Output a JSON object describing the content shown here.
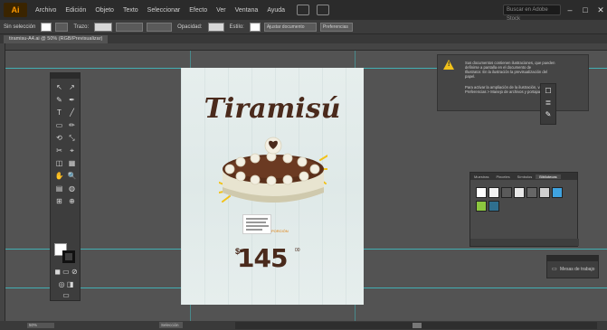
{
  "app": {
    "logo": "Ai",
    "menu": [
      "Archivo",
      "Edición",
      "Objeto",
      "Texto",
      "Seleccionar",
      "Efecto",
      "Ver",
      "Ventana",
      "Ayuda"
    ],
    "search_placeholder": "Buscar en Adobe Stock",
    "window_controls": [
      "–",
      "□",
      "✕"
    ]
  },
  "control_bar": {
    "selection_label": "Sin selección",
    "stroke_label": "Trazo:",
    "opacity_label": "Opacidad:",
    "style_label": "Estilo:",
    "doc_setup_button": "Ajustar documento",
    "preferences_button": "Preferencias"
  },
  "document": {
    "tab_title": "tiramisu-A4.ai @ 50% (RGB/Previsualizar)"
  },
  "artboard": {
    "title": "Tiramisú",
    "price": "145",
    "price_currency": "$",
    "price_superscript": "00",
    "info_tag": "PORCIÓN"
  },
  "toolbox": {
    "tools": [
      "↖",
      "↗",
      "✎",
      "✒",
      "T",
      "╱",
      "▭",
      "✏",
      "⟲",
      "⤡",
      "✂",
      "⌖",
      "◫",
      "▦",
      "✋",
      "🔍",
      "▤",
      "◍",
      "⊞",
      "⊕"
    ]
  },
  "warning_panel": {
    "line1": "Sus documentos contienen ilustraciones, que pueden",
    "line2": "definirse a pantalla en el documento de",
    "line3": "Illustrator. En la ilustración la previsualización del",
    "line4": "papel.",
    "line5": "Para activar la ampliación de la ilustración, vaya a",
    "line6": "Preferencias > Manejo de archivos y portapapeles."
  },
  "swatches_panel": {
    "tabs": [
      "Muestras",
      "Pinceles",
      "Símbolos",
      "Bibliotecas"
    ]
  },
  "artboards_panel": {
    "label": "Mesas de trabajo"
  },
  "status_bar": {
    "zoom": "50%",
    "tool": "Selección"
  },
  "colors": {
    "accent": "#ef7c0e",
    "title_brown": "#4a2a1c",
    "guide": "#3fbfc4",
    "warning_yellow": "#f2c21a"
  }
}
